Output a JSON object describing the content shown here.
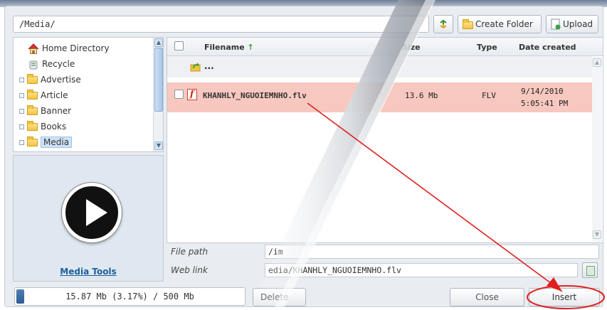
{
  "toolbar": {
    "path": "/Media/",
    "create_folder_label": "Create Folder",
    "upload_label": "Upload"
  },
  "sidebar": {
    "items": [
      {
        "label": "Home Directory",
        "icon": "home-icon"
      },
      {
        "label": "Recycle",
        "icon": "recycle-bin-icon"
      },
      {
        "label": "Advertise",
        "icon": "folder-icon"
      },
      {
        "label": "Article",
        "icon": "folder-icon"
      },
      {
        "label": "Banner",
        "icon": "folder-icon"
      },
      {
        "label": "Books",
        "icon": "folder-icon"
      },
      {
        "label": "Media",
        "icon": "folder-open-icon",
        "selected": true
      }
    ],
    "media_tools_label": "Media Tools"
  },
  "list": {
    "columns": {
      "filename": "Filename",
      "size": "Size",
      "type": "Type",
      "date": "Date created"
    },
    "up_label": "...",
    "files": [
      {
        "name": "KHANHLY_NGUOIEMNHO.flv",
        "size": "13.6 Mb",
        "type": "FLV",
        "date": "9/14/2010",
        "time": "5:05:41 PM"
      }
    ]
  },
  "fields": {
    "file_path_label": "File path",
    "file_path_value": "/im",
    "web_link_label": "Web link",
    "web_link_value": "edia/KHANHLY_NGUOIEMNHO.flv"
  },
  "footer": {
    "quota_text": "15.87 Mb (3.17%) / 500 Mb",
    "quota_percent": 3.17,
    "delete_label": "Delete",
    "close_label": "Close",
    "insert_label": "Insert"
  },
  "colors": {
    "selected_row": "#f7c8bf",
    "annotation": "#e02020",
    "link": "#1f5e99"
  }
}
